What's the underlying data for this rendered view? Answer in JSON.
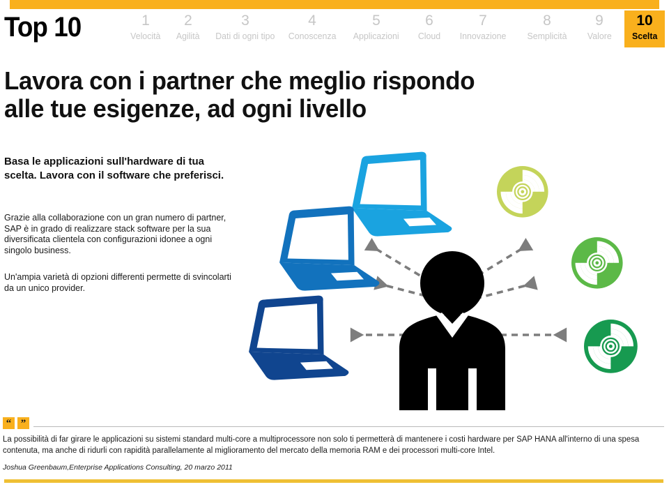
{
  "brand": {
    "label": "Top 10"
  },
  "nav": {
    "items": [
      {
        "num": "1",
        "label": "Velocità",
        "active": false
      },
      {
        "num": "2",
        "label": "Agilità",
        "active": false
      },
      {
        "num": "3",
        "label": "Dati di ogni tipo",
        "active": false
      },
      {
        "num": "4",
        "label": "Conoscenza",
        "active": false
      },
      {
        "num": "5",
        "label": "Applicazioni",
        "active": false
      },
      {
        "num": "6",
        "label": "Cloud",
        "active": false
      },
      {
        "num": "7",
        "label": "Innovazione",
        "active": false
      },
      {
        "num": "8",
        "label": "Semplicità",
        "active": false
      },
      {
        "num": "9",
        "label": "Valore",
        "active": false
      },
      {
        "num": "10",
        "label": "Scelta",
        "active": true
      }
    ]
  },
  "title": "Lavora con i partner che meglio rispondo alle tue esigenze, ad ogni livello",
  "lead": "Basa le applicazioni sull'hardware di tua scelta. Lavora con il software che preferisci.",
  "body_1": "Grazie alla collaborazione con un gran numero di partner, SAP è in grado di realizzare stack software per la sua diversificata clientela con configurazioni idonee a ogni singolo business.",
  "body_2": "Un'ampia varietà di opzioni differenti permette di svincolarti da un unico provider.",
  "quote": {
    "open_mark": "“",
    "close_mark": "”",
    "text": "La possibilità di far girare le applicazioni su sistemi standard multi-core a multiprocessore non solo ti permetterà di mantenere i costi hardware per SAP HANA all'interno di una spesa contenuta, ma anche di ridurli con rapidità parallelamente al miglioramento del mercato della memoria RAM e dei processori multi-core Intel.",
    "attribution": "Joshua Greenbaum,Enterprise Applications Consulting, 20 marzo 2011"
  },
  "illustration": {
    "laptops": [
      {
        "name": "laptop-light-blue",
        "color": "#1aa3e0"
      },
      {
        "name": "laptop-medium-blue",
        "color": "#1272bd"
      },
      {
        "name": "laptop-dark-blue",
        "color": "#10458f"
      }
    ],
    "discs": [
      {
        "name": "disc-light-green",
        "color": "#c4d45a"
      },
      {
        "name": "disc-medium-green",
        "color": "#5cb947"
      },
      {
        "name": "disc-dark-green",
        "color": "#179a50"
      }
    ],
    "person": {
      "name": "person-silhouette",
      "color": "#000000"
    },
    "arrow_color": "#7d7d7d"
  },
  "colors": {
    "accent_yellow": "#f9b01d",
    "bottom_bar_yellow": "#efc034",
    "nav_grey": "#c6c6c6",
    "text_dark": "#111111"
  }
}
